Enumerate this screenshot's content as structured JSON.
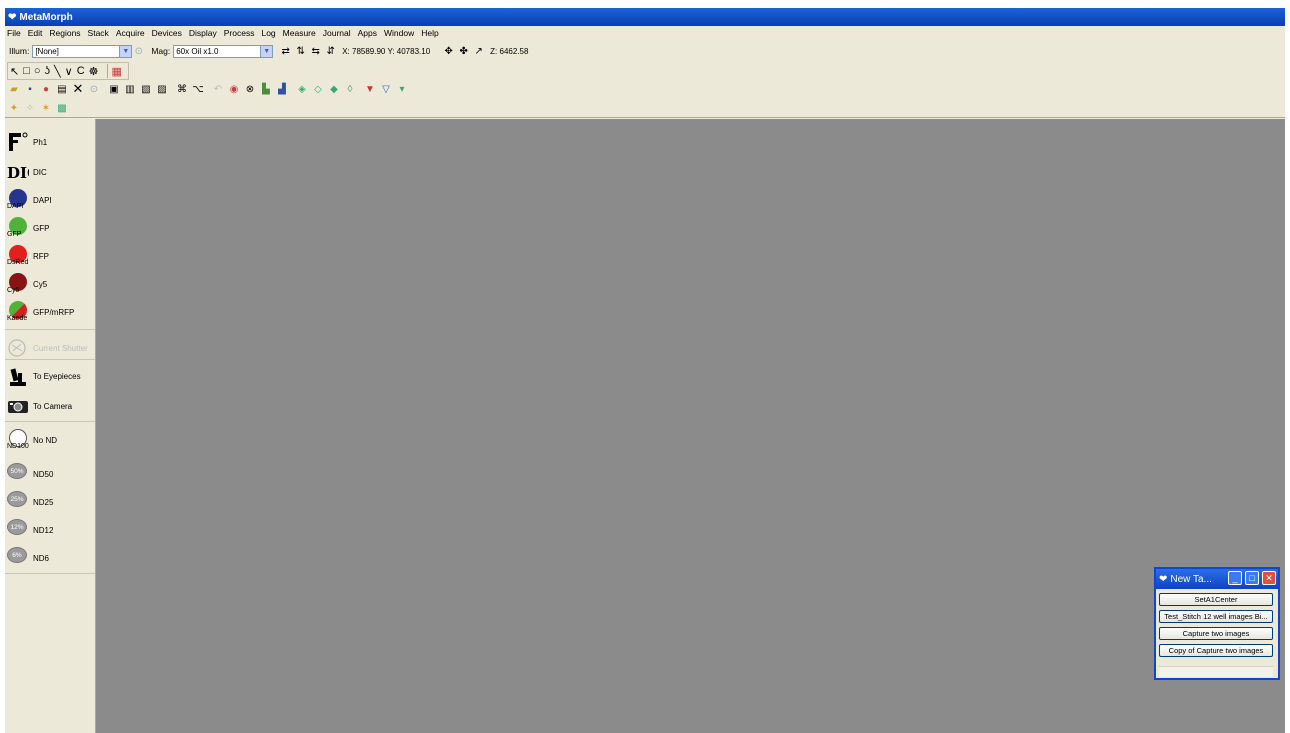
{
  "title": "MetaMorph",
  "menu": [
    "File",
    "Edit",
    "Regions",
    "Stack",
    "Acquire",
    "Devices",
    "Display",
    "Process",
    "Log",
    "Measure",
    "Journal",
    "Apps",
    "Window",
    "Help"
  ],
  "illum": {
    "label": "Illum:",
    "value": "[None]"
  },
  "mag": {
    "label": "Mag:",
    "value": "60x Oil x1.0"
  },
  "coords": {
    "xy": "X: 78589.90  Y: 40783.10",
    "z": "Z: 6462.58"
  },
  "sidebar": {
    "filters": [
      {
        "name": "Ph1",
        "color": "#000000"
      },
      {
        "name": "DIC",
        "color": "#000000"
      },
      {
        "name": "DAPI",
        "sub": "DAPI",
        "color": "#25368c"
      },
      {
        "name": "GFP",
        "sub": "GFP",
        "color": "#4fb33a"
      },
      {
        "name": "RFP",
        "sub": "DsRed",
        "color": "#e0211d"
      },
      {
        "name": "Cy5",
        "sub": "Cy5",
        "color": "#8a1414"
      },
      {
        "name": "GFP/mRFP",
        "sub": "Kaede",
        "color": "#d62020"
      }
    ],
    "shutter": "Current Shutter",
    "eyepieces": "To Eyepieces",
    "camera": "To Camera",
    "nd": [
      {
        "name": "No ND",
        "sub": "ND100"
      },
      {
        "name": "ND50",
        "badge": "50%"
      },
      {
        "name": "ND25",
        "badge": "25%"
      },
      {
        "name": "ND12",
        "badge": "12%"
      },
      {
        "name": "ND6",
        "badge": "6%"
      }
    ]
  },
  "tasks": {
    "title": "New Ta...",
    "buttons": [
      "SetA1Center",
      "Test_Stitch 12 well images Bi...",
      "Capture two images",
      "Copy of Capture two images"
    ]
  },
  "colors": {
    "title_bar": "#0a3fb3",
    "workspace": "#8b8b8b",
    "panel": "#ece9d8"
  }
}
